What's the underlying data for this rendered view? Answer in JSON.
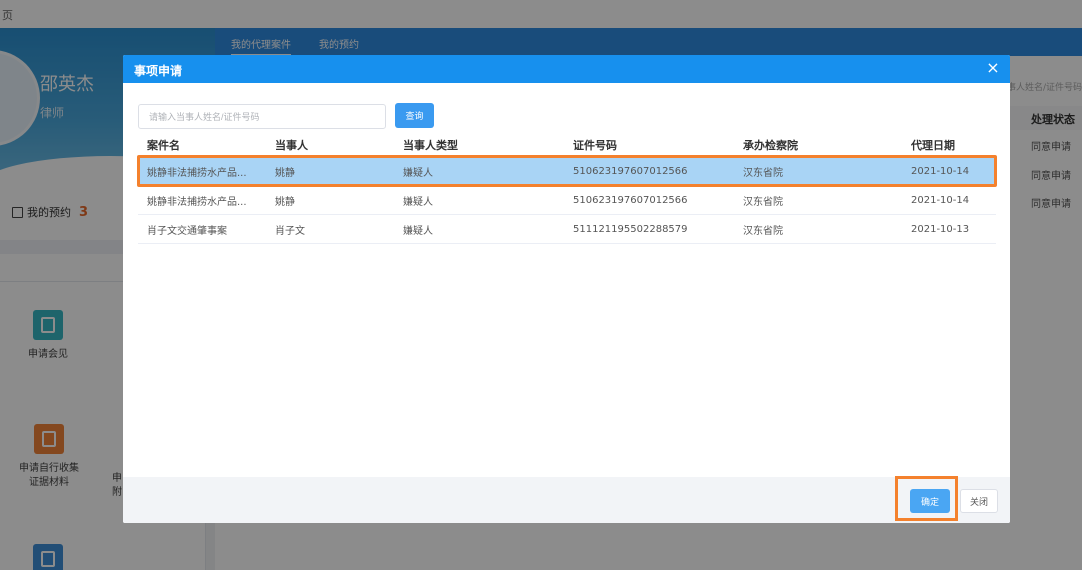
{
  "topbar": {
    "crumb": "页"
  },
  "profile": {
    "name": "邵英杰",
    "role": "律师"
  },
  "appointment": {
    "label": "我的预约",
    "count": "3"
  },
  "tiles": [
    {
      "label": "申请会见"
    },
    {
      "label": "申请自行收集证据材料"
    },
    {
      "label_partial": "申附"
    }
  ],
  "main": {
    "tabs": [
      {
        "label": "我的代理案件"
      },
      {
        "label": "我的预约"
      }
    ],
    "search_hint": "事人姓名/证件号码",
    "status_header": "处理状态",
    "status_values": [
      "同意申请",
      "同意申请",
      "同意申请"
    ]
  },
  "modal": {
    "title": "事项申请",
    "close_icon": "×",
    "search": {
      "placeholder": "请输入当事人姓名/证件号码",
      "value": "",
      "button": "查询"
    },
    "table": {
      "columns": [
        "案件名",
        "当事人",
        "当事人类型",
        "证件号码",
        "承办检察院",
        "代理日期"
      ],
      "rows": [
        {
          "case": "姚静非法捕捞水产品...",
          "party": "姚静",
          "type": "嫌疑人",
          "id": "510623197607012566",
          "office": "汉东省院",
          "date": "2021-10-14",
          "selected": true
        },
        {
          "case": "姚静非法捕捞水产品...",
          "party": "姚静",
          "type": "嫌疑人",
          "id": "510623197607012566",
          "office": "汉东省院",
          "date": "2021-10-14",
          "selected": false
        },
        {
          "case": "肖子文交通肇事案",
          "party": "肖子文",
          "type": "嫌疑人",
          "id": "511121195502288579",
          "office": "汉东省院",
          "date": "2021-10-13",
          "selected": false
        }
      ]
    },
    "footer": {
      "confirm": "确定",
      "close": "关闭"
    }
  },
  "colors": {
    "header_blue": "#1790ee",
    "selected_row": "#a9d4f5",
    "highlight": "#f4812d",
    "button_blue": "#4aa6f3"
  }
}
